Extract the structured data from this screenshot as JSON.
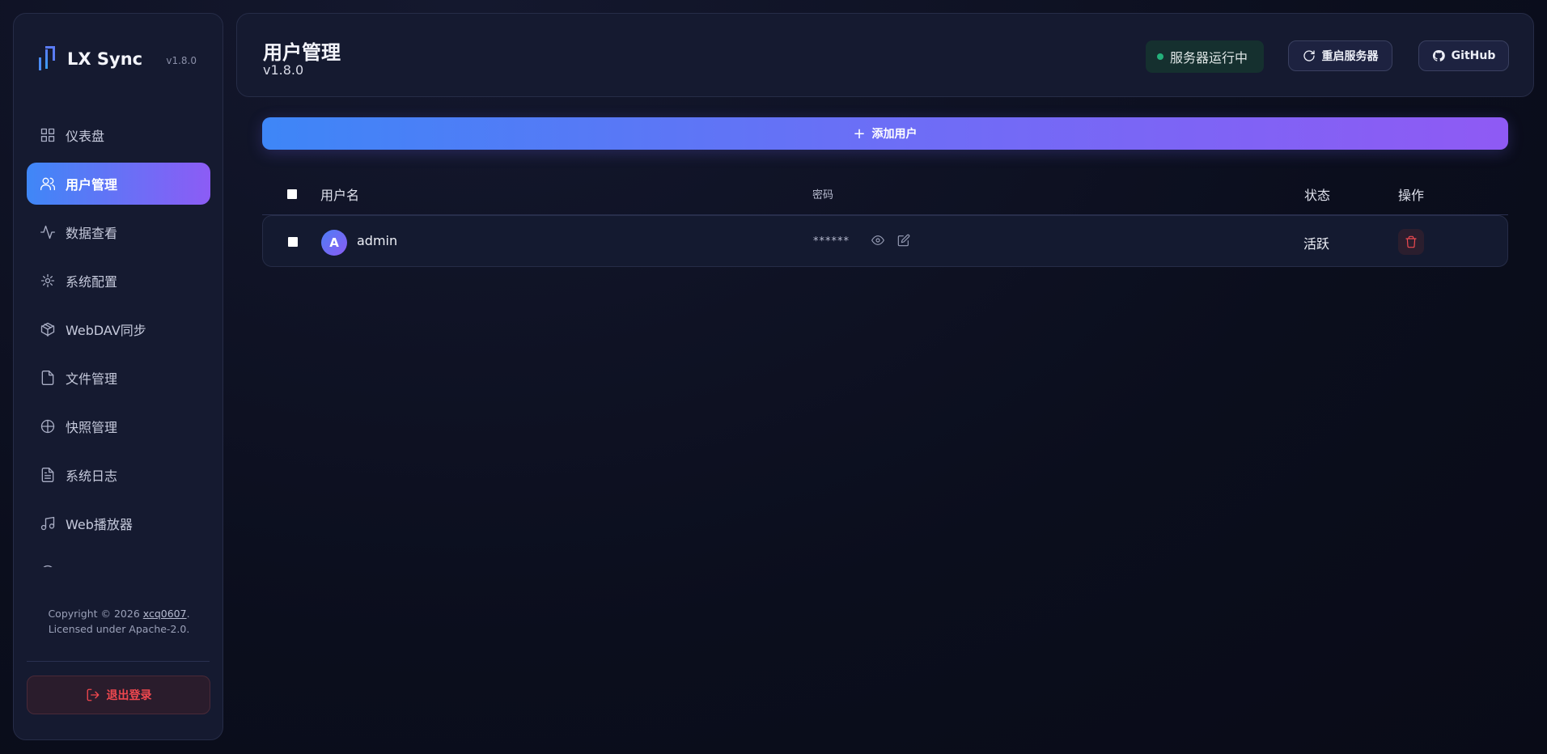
{
  "brand": {
    "name": "LX Sync",
    "version": "v1.8.0",
    "logo_icon": "lx-logo-icon"
  },
  "sidebar": {
    "items": [
      {
        "label": "仪表盘",
        "icon": "grid-icon",
        "active": false
      },
      {
        "label": "用户管理",
        "icon": "users-icon",
        "active": true
      },
      {
        "label": "数据查看",
        "icon": "activity-icon",
        "active": false
      },
      {
        "label": "系统配置",
        "icon": "sun-icon",
        "active": false
      },
      {
        "label": "WebDAV同步",
        "icon": "box-icon",
        "active": false
      },
      {
        "label": "文件管理",
        "icon": "file-icon",
        "active": false
      },
      {
        "label": "快照管理",
        "icon": "globe-icon",
        "active": false
      },
      {
        "label": "系统日志",
        "icon": "file-text-icon",
        "active": false
      },
      {
        "label": "Web播放器",
        "icon": "music-icon",
        "active": false
      }
    ],
    "copyright_prefix": "Copyright © 2026 ",
    "copyright_author": "xcq0607",
    "copyright_suffix": ".",
    "license": "Licensed under Apache-2.0.",
    "logout_label": "退出登录"
  },
  "header": {
    "title": "用户管理",
    "subtitle": "v1.8.0",
    "status_text": "服务器运行中",
    "status_color": "#24b07a",
    "restart_label": "重启服务器",
    "github_label": "GitHub"
  },
  "main": {
    "add_user_label": "添加用户",
    "columns": {
      "username": "用户名",
      "password": "密码",
      "status": "状态",
      "actions": "操作"
    },
    "rows": [
      {
        "avatar": "A",
        "username": "admin",
        "password": "******",
        "status": "活跃"
      }
    ]
  },
  "colors": {
    "accent_start": "#3e86f7",
    "accent_end": "#8f5af4",
    "danger": "#ef4a50"
  }
}
